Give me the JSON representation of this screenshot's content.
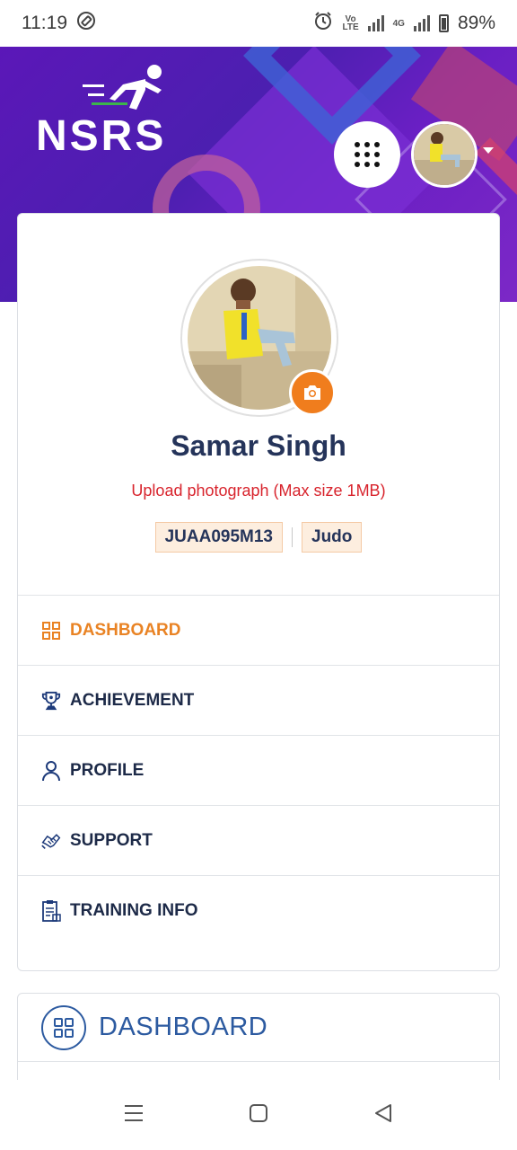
{
  "status_bar": {
    "time": "11:19",
    "network_label_top": "Vo",
    "network_label_bottom": "LTE",
    "network_type": "4G",
    "battery": "89%"
  },
  "header": {
    "logo_text": "NSRS",
    "apps_icon": "grid-dots-icon",
    "avatar_icon": "user-photo",
    "dropdown_icon": "caret-down-icon"
  },
  "profile": {
    "name": "Samar Singh",
    "upload_note": "Upload photograph (Max size 1MB)",
    "athlete_id": "JUAA095M13",
    "sport": "Judo",
    "camera_icon": "camera-icon"
  },
  "menu": {
    "items": [
      {
        "label": "DASHBOARD",
        "icon": "dashboard-grid-icon",
        "active": true
      },
      {
        "label": "ACHIEVEMENT",
        "icon": "trophy-icon",
        "active": false
      },
      {
        "label": "PROFILE",
        "icon": "user-icon",
        "active": false
      },
      {
        "label": "SUPPORT",
        "icon": "handshake-icon",
        "active": false
      },
      {
        "label": "TRAINING INFO",
        "icon": "clipboard-icon",
        "active": false
      }
    ]
  },
  "dashboard_section": {
    "title": "DASHBOARD",
    "icon": "dashboard-grid-icon"
  },
  "colors": {
    "accent_orange": "#e98324",
    "brand_purple": "#5b17b8",
    "title_navy": "#25345a",
    "dashboard_blue": "#2c5aa0",
    "warning_red": "#d8242d"
  }
}
